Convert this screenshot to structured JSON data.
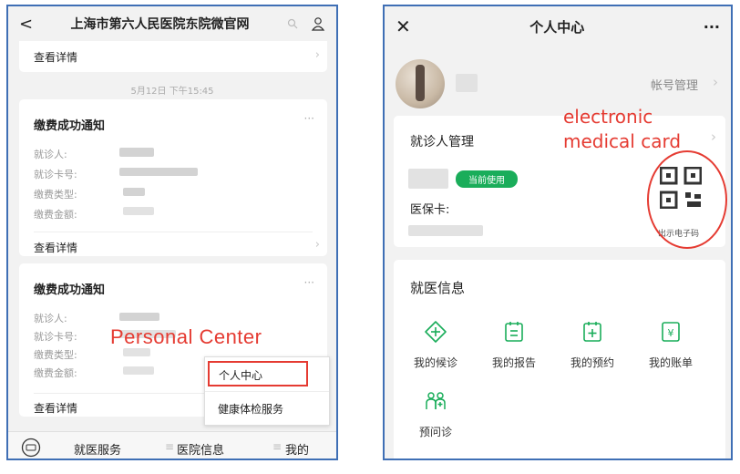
{
  "left": {
    "title": "上海市第六人民医院东院微官网",
    "top_detail": "查看详情",
    "timestamp": "5月12日 下午15:45",
    "card1": {
      "title": "缴费成功通知",
      "more": "···",
      "fields": [
        "就诊人:",
        "就诊卡号:",
        "缴费类型:",
        "缴费金额:"
      ],
      "detail": "查看详情"
    },
    "card2": {
      "title": "缴费成功通知",
      "more": "···",
      "fields": [
        "就诊人:",
        "就诊卡号:",
        "缴费类型:",
        "缴费金额:"
      ],
      "detail": "查看详情"
    },
    "popup": [
      "个人中心",
      "健康体检服务"
    ],
    "tabs": [
      "就医服务",
      "医院信息",
      "我的"
    ],
    "annotation": "Personal Center"
  },
  "right": {
    "title": "个人中心",
    "more": "···",
    "account_link": "帐号管理",
    "patient_title": "就诊人管理",
    "current_badge": "当前使用",
    "insurance_label": "医保卡:",
    "qr_caption": "出示电子码",
    "annotation": [
      "electronic",
      "medical card"
    ],
    "section_title": "就医信息",
    "services": [
      {
        "label": "我的候诊",
        "icon": "plus-diamond-icon"
      },
      {
        "label": "我的报告",
        "icon": "report-icon"
      },
      {
        "label": "我的预约",
        "icon": "calendar-plus-icon"
      },
      {
        "label": "我的账单",
        "icon": "bill-icon"
      },
      {
        "label": "预问诊",
        "icon": "pre-consult-icon"
      }
    ]
  },
  "colors": {
    "accent_green": "#1aad5a",
    "annotation_red": "#e53b32",
    "frame_blue": "#3f6fb5"
  }
}
